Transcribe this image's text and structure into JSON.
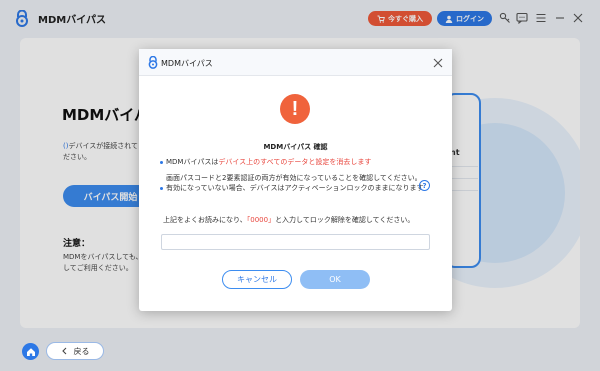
{
  "app": {
    "title": "MDMバイパス",
    "buy_label": "今すぐ購入",
    "login_label": "ログイン"
  },
  "main": {
    "title": "MDMバイパス",
    "desc_line1_prefix": "()",
    "desc_line1": "デバイスが接続されて",
    "desc_line2": "ださい。",
    "bypass_button": "バイパス開始",
    "note_title": "注意：",
    "note_line1": "MDMをバイパスしても、",
    "note_line2": "してご利用ください。",
    "bg_text": "nt"
  },
  "dialog": {
    "title": "MDMバイパス",
    "confirm_title": "MDMバイパス 確認",
    "item1_prefix": "MDMバイパスは",
    "item1_red": "デバイス上のすべてのデータと設定を消去します",
    "item2_line1": "画面パスコードと2要素認証の両方が有効になっていることを確認してください。",
    "item3": "有効になっていない場合、デバイスはアクティベーションロックのままになります",
    "instruction_prefix": "上記をよくお読みになり、",
    "instruction_code": "「0000」",
    "instruction_suffix": "と入力してロック解除を確認してください。",
    "input_value": "",
    "input_placeholder": "",
    "cancel_label": "キャンセル",
    "ok_label": "OK"
  },
  "footer": {
    "back_label": "戻る"
  },
  "colors": {
    "accent": "#2d78e6",
    "buy": "#f0593a",
    "warning": "#f0633c",
    "danger_text": "#e8453c"
  },
  "icons": [
    "lock-logo-icon",
    "cart-icon",
    "user-icon",
    "key-icon",
    "chat-icon",
    "menu-icon",
    "minimize-icon",
    "close-icon",
    "warning-icon",
    "help-icon",
    "home-icon",
    "back-arrow-icon"
  ]
}
